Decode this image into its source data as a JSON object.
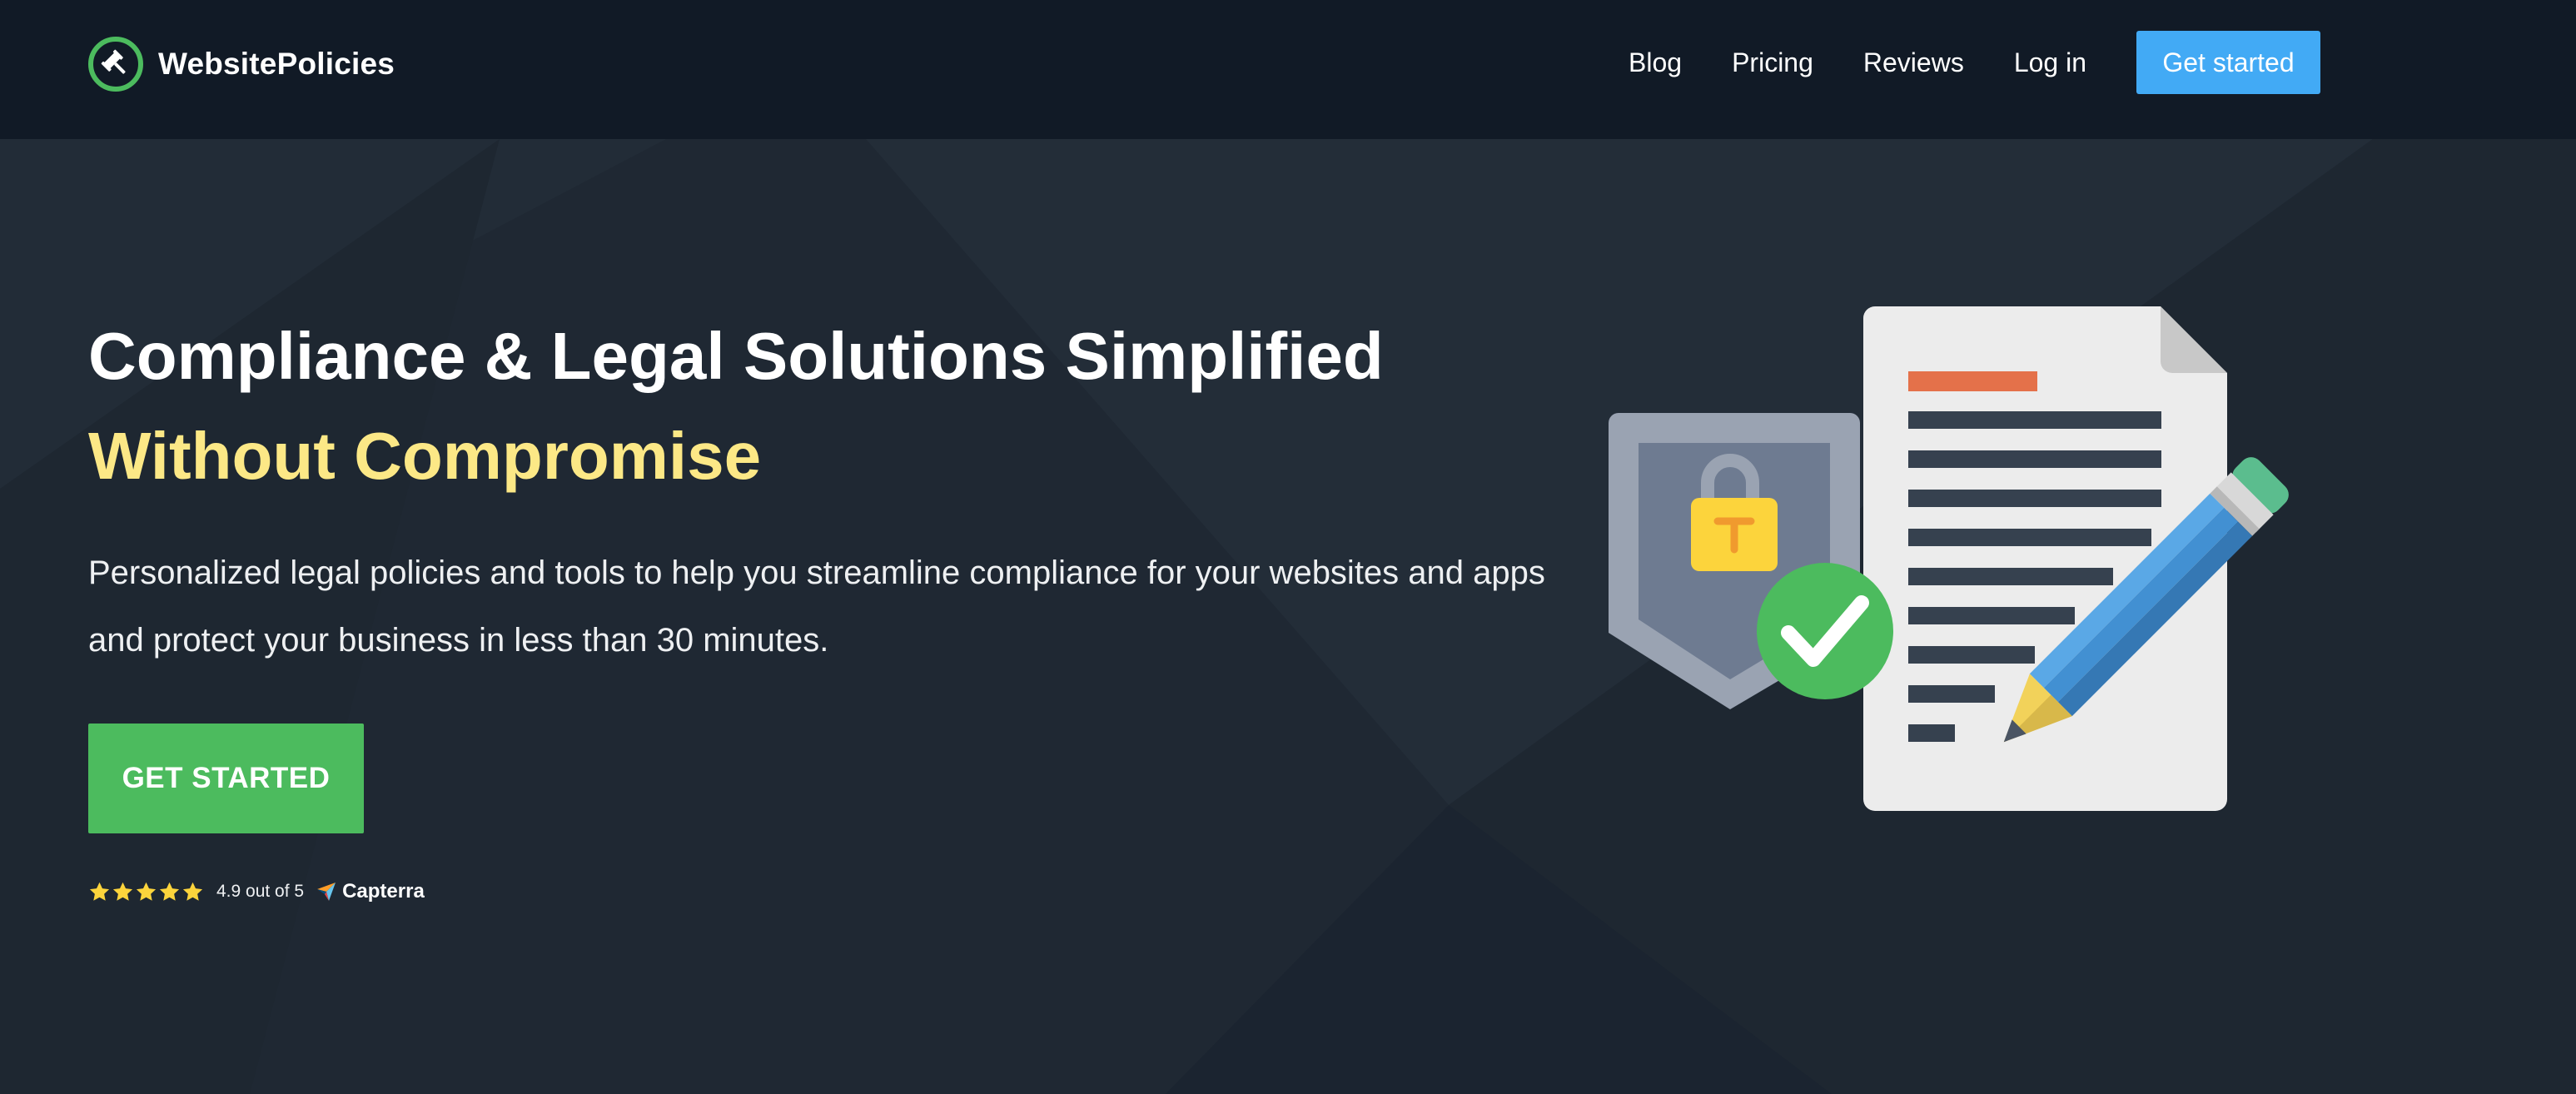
{
  "header": {
    "brand_name": "WebsitePolicies",
    "brand_icon": "gavel-icon",
    "nav": [
      {
        "label": "Blog"
      },
      {
        "label": "Pricing"
      },
      {
        "label": "Reviews"
      },
      {
        "label": "Log in"
      }
    ],
    "cta_label": "Get started"
  },
  "hero": {
    "title_line1": "Compliance & Legal Solutions Simplified",
    "title_line2": "Without Compromise",
    "description": "Personalized legal policies and tools to help you streamline compliance for your websites and apps and protect your business in less than 30 minutes.",
    "button_label": "GET STARTED",
    "rating": {
      "stars": 5,
      "text": "4.9 out of 5",
      "source": "Capterra"
    },
    "illustration_icons": [
      "shield-lock-icon",
      "document-icon",
      "checkmark-icon",
      "pencil-icon"
    ]
  },
  "colors": {
    "header_bg": "#111a26",
    "hero_bg": "#1f2833",
    "accent_green": "#4cbb5e",
    "accent_blue": "#42aaf5",
    "highlight_yellow": "#fce886",
    "star_yellow": "#fcd43c"
  }
}
